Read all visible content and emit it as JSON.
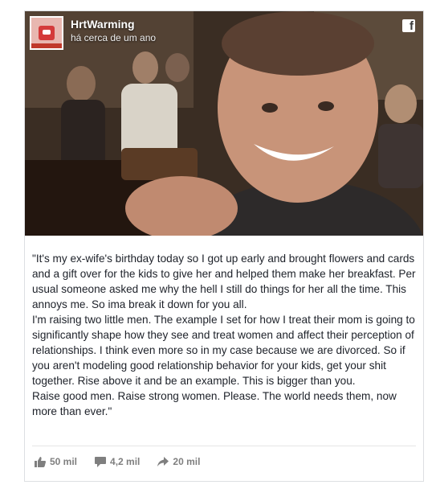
{
  "post": {
    "page_name": "HrtWarming",
    "timestamp": "há cerca de um ano",
    "paragraphs": [
      "\"It's my ex-wife's birthday today so I got up early and brought flowers and cards and a gift over for the kids to give her and helped them make her breakfast. Per usual someone asked me why the hell I still do things for her all the time. This annoys me. So ima break it down for you all.",
      "I'm raising two little men. The example I set for how I treat their mom is going to significantly shape how they see and treat women and affect their perception of relationships. I think even more so in my case because we are divorced. So if you aren't modeling good relationship behavior for your kids, get your shit together. Rise above it and be an example. This is bigger than you.",
      "Raise good men. Raise strong women. Please. The world needs them, now more than ever.\""
    ]
  },
  "stats": {
    "likes": "50 mil",
    "comments": "4,2 mil",
    "shares": "20 mil"
  },
  "icons": {
    "platform": "facebook-icon",
    "like": "thumbs-up-icon",
    "comment": "speech-bubble-icon",
    "share": "share-arrow-icon"
  },
  "colors": {
    "stat_text": "#7f7f7f",
    "body_text": "#1d2129",
    "border": "#dddfe2"
  }
}
